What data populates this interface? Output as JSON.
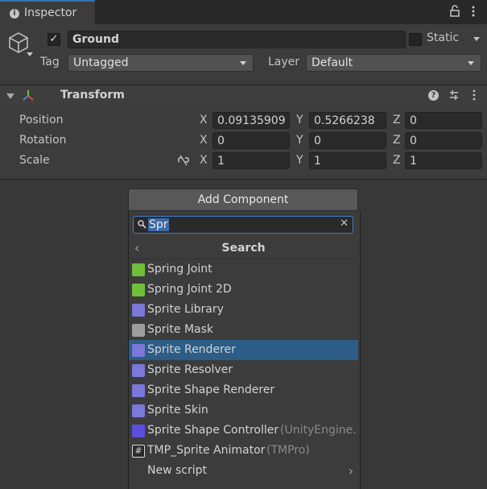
{
  "tab": {
    "title": "Inspector",
    "lock_icon": "lock-icon",
    "menu_icon": "kebab-menu-icon"
  },
  "object": {
    "name": "Ground",
    "active": true,
    "static_label": "Static",
    "static_checked": false,
    "tag_label": "Tag",
    "tag_value": "Untagged",
    "layer_label": "Layer",
    "layer_value": "Default"
  },
  "transform": {
    "title": "Transform",
    "rows": [
      {
        "label": "Position",
        "x": "0.09135909",
        "y": "0.5266238",
        "z": "0"
      },
      {
        "label": "Rotation",
        "x": "0",
        "y": "0",
        "z": "0"
      },
      {
        "label": "Scale",
        "x": "1",
        "y": "1",
        "z": "1"
      }
    ],
    "axes": {
      "x": "X",
      "y": "Y",
      "z": "Z"
    }
  },
  "add_component": {
    "button_label": "Add Component",
    "search_value": "Spr",
    "panel_title": "Search",
    "items": [
      {
        "label": "Spring Joint",
        "suffix": "",
        "icon": "spring-joint-icon",
        "color": "#6fbf3a",
        "selected": false
      },
      {
        "label": "Spring Joint 2D",
        "suffix": "",
        "icon": "spring-joint-2d-icon",
        "color": "#6fbf3a",
        "selected": false
      },
      {
        "label": "Sprite Library",
        "suffix": "",
        "icon": "sprite-library-icon",
        "color": "#7a78d8",
        "selected": false
      },
      {
        "label": "Sprite Mask",
        "suffix": "",
        "icon": "sprite-mask-icon",
        "color": "#9d9d9d",
        "selected": false
      },
      {
        "label": "Sprite Renderer",
        "suffix": "",
        "icon": "sprite-renderer-icon",
        "color": "#7a78d8",
        "selected": true
      },
      {
        "label": "Sprite Resolver",
        "suffix": "",
        "icon": "sprite-resolver-icon",
        "color": "#7a78d8",
        "selected": false
      },
      {
        "label": "Sprite Shape Renderer",
        "suffix": "",
        "icon": "sprite-shape-renderer-icon",
        "color": "#7a78d8",
        "selected": false
      },
      {
        "label": "Sprite Skin",
        "suffix": "",
        "icon": "sprite-skin-icon",
        "color": "#7a78d8",
        "selected": false
      },
      {
        "label": "Sprite Shape Controller",
        "suffix": "(UnityEngine.",
        "icon": "sprite-shape-controller-icon",
        "color": "#5b4fe0",
        "selected": false
      },
      {
        "label": "TMP_Sprite Animator",
        "suffix": "(TMPro)",
        "icon": "script-icon",
        "color": "#d8d8d8",
        "selected": false
      },
      {
        "label": "New script",
        "suffix": "",
        "icon": "",
        "color": "",
        "selected": false
      }
    ]
  },
  "colors": {
    "accent": "#3a72b0",
    "selection": "#2c5d87",
    "background": "#383838"
  }
}
